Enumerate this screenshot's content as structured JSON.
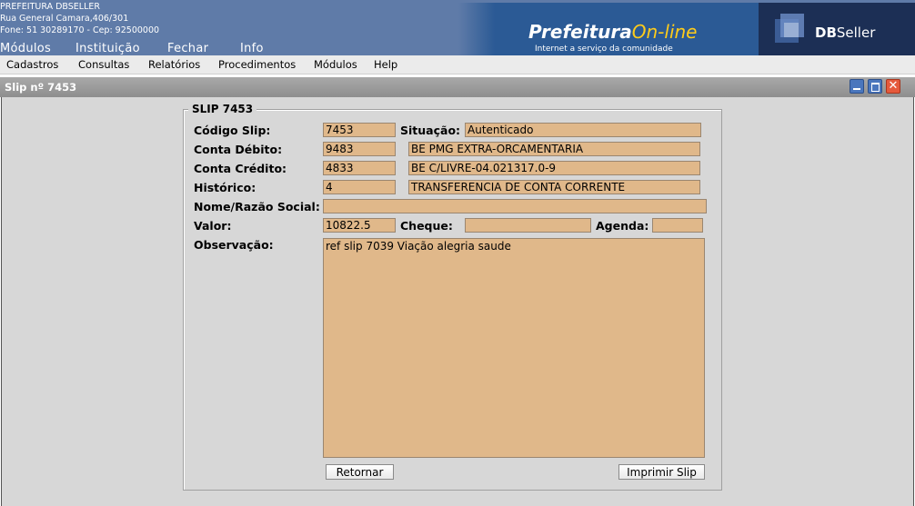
{
  "header": {
    "org_name": "PREFEITURA DBSELLER",
    "address": "Rua General Camara,406/301",
    "phone_line": "Fone: 51 30289170  -  Cep: 92500000",
    "top_menu": [
      "Módulos",
      "Instituição",
      "Fechar",
      "Info"
    ],
    "banner_title_main": "Prefeitura",
    "banner_title_accent": "On-line",
    "banner_subtitle": "Internet a serviço da comunidade",
    "vendor_logo_bold": "DB",
    "vendor_logo_rest": "Seller"
  },
  "menubar": [
    "Cadastros",
    "Consultas",
    "Relatórios",
    "Procedimentos",
    "Módulos",
    "Help"
  ],
  "window": {
    "title": "Slip nº 7453"
  },
  "form": {
    "legend": "SLIP 7453",
    "labels": {
      "codigo_slip": "Código Slip:",
      "situacao": "Situação:",
      "conta_debito": "Conta Débito:",
      "conta_credito": "Conta Crédito:",
      "historico": "Histórico:",
      "nome_razao": "Nome/Razão Social:",
      "valor": "Valor:",
      "cheque": "Cheque:",
      "agenda": "Agenda:",
      "observacao": "Observação:"
    },
    "values": {
      "codigo_slip": "7453",
      "situacao": "Autenticado",
      "conta_debito_code": "9483",
      "conta_debito_desc": "BE PMG EXTRA-ORCAMENTARIA",
      "conta_credito_code": "4833",
      "conta_credito_desc": "BE C/LIVRE-04.021317.0-9",
      "historico_code": "4",
      "historico_desc": "TRANSFERENCIA DE CONTA CORRENTE",
      "nome_razao": "",
      "valor": "10822.5",
      "cheque": "",
      "agenda": "",
      "observacao": "ref slip 7039 Viação alegria saude"
    },
    "buttons": {
      "retornar": "Retornar",
      "imprimir": "Imprimir Slip"
    }
  },
  "colors": {
    "header_bg": "#5f7ba8",
    "field_bg": "#e0b88a",
    "window_bg": "#d7d7d7",
    "accent_online": "#ffcc1a"
  }
}
